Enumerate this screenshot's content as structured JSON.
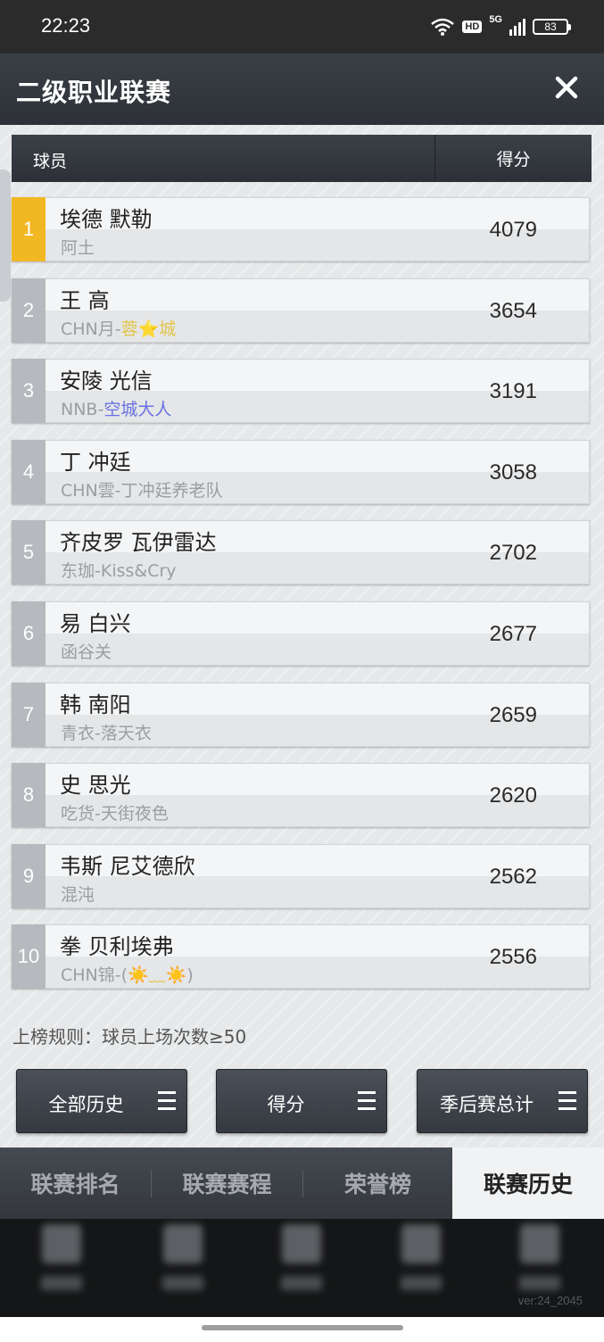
{
  "status_bar": {
    "time": "22:23",
    "network": "5G",
    "hd": "HD",
    "battery": "83"
  },
  "header": {
    "title": "二级职业联赛"
  },
  "table": {
    "col_player": "球员",
    "col_score": "得分",
    "rows": [
      {
        "rank": "1",
        "name": "埃德 默勒",
        "team_prefix": "阿土",
        "team_highlight": "",
        "team_suffix": "",
        "score": "4079"
      },
      {
        "rank": "2",
        "name": "王 高",
        "team_prefix": "CHN月-",
        "team_highlight": "蓉⭐城",
        "team_suffix": "",
        "score": "3654"
      },
      {
        "rank": "3",
        "name": "安陵 光信",
        "team_prefix": "NNB-",
        "team_highlight": "空城大人",
        "team_suffix": "",
        "score": "3191"
      },
      {
        "rank": "4",
        "name": "丁 冲廷",
        "team_prefix": "CHN雲-丁冲廷养老队",
        "team_highlight": "",
        "team_suffix": "",
        "score": "3058"
      },
      {
        "rank": "5",
        "name": "齐皮罗 瓦伊雷达",
        "team_prefix": "东珈-Kiss&Cry",
        "team_highlight": "",
        "team_suffix": "",
        "score": "2702"
      },
      {
        "rank": "6",
        "name": "易 白兴",
        "team_prefix": "函谷关",
        "team_highlight": "",
        "team_suffix": "",
        "score": "2677"
      },
      {
        "rank": "7",
        "name": "韩 南阳",
        "team_prefix": "青衣-落天衣",
        "team_highlight": "",
        "team_suffix": "",
        "score": "2659"
      },
      {
        "rank": "8",
        "name": "史 思光",
        "team_prefix": "吃货-天街夜色",
        "team_highlight": "",
        "team_suffix": "",
        "score": "2620"
      },
      {
        "rank": "9",
        "name": "韦斯 尼艾德欣",
        "team_prefix": "混沌",
        "team_highlight": "",
        "team_suffix": "",
        "score": "2562"
      },
      {
        "rank": "10",
        "name": "拳 贝利埃弗",
        "team_prefix": "CHN锦-(",
        "team_highlight": "☀️﹏☀️",
        "team_suffix": ")",
        "score": "2556"
      }
    ]
  },
  "rule": "上榜规则：球员上场次数≥50",
  "filters": {
    "history": "全部历史",
    "stat": "得分",
    "season": "季后赛总计"
  },
  "tabs": [
    "联赛排名",
    "联赛赛程",
    "荣誉榜",
    "联赛历史"
  ],
  "version": "ver:24_2045",
  "colors": {
    "rank_first": "#f2b823",
    "header_bg": "#2e3238",
    "highlight_gold": "#e3c44a",
    "highlight_blue": "#6a71e0"
  }
}
